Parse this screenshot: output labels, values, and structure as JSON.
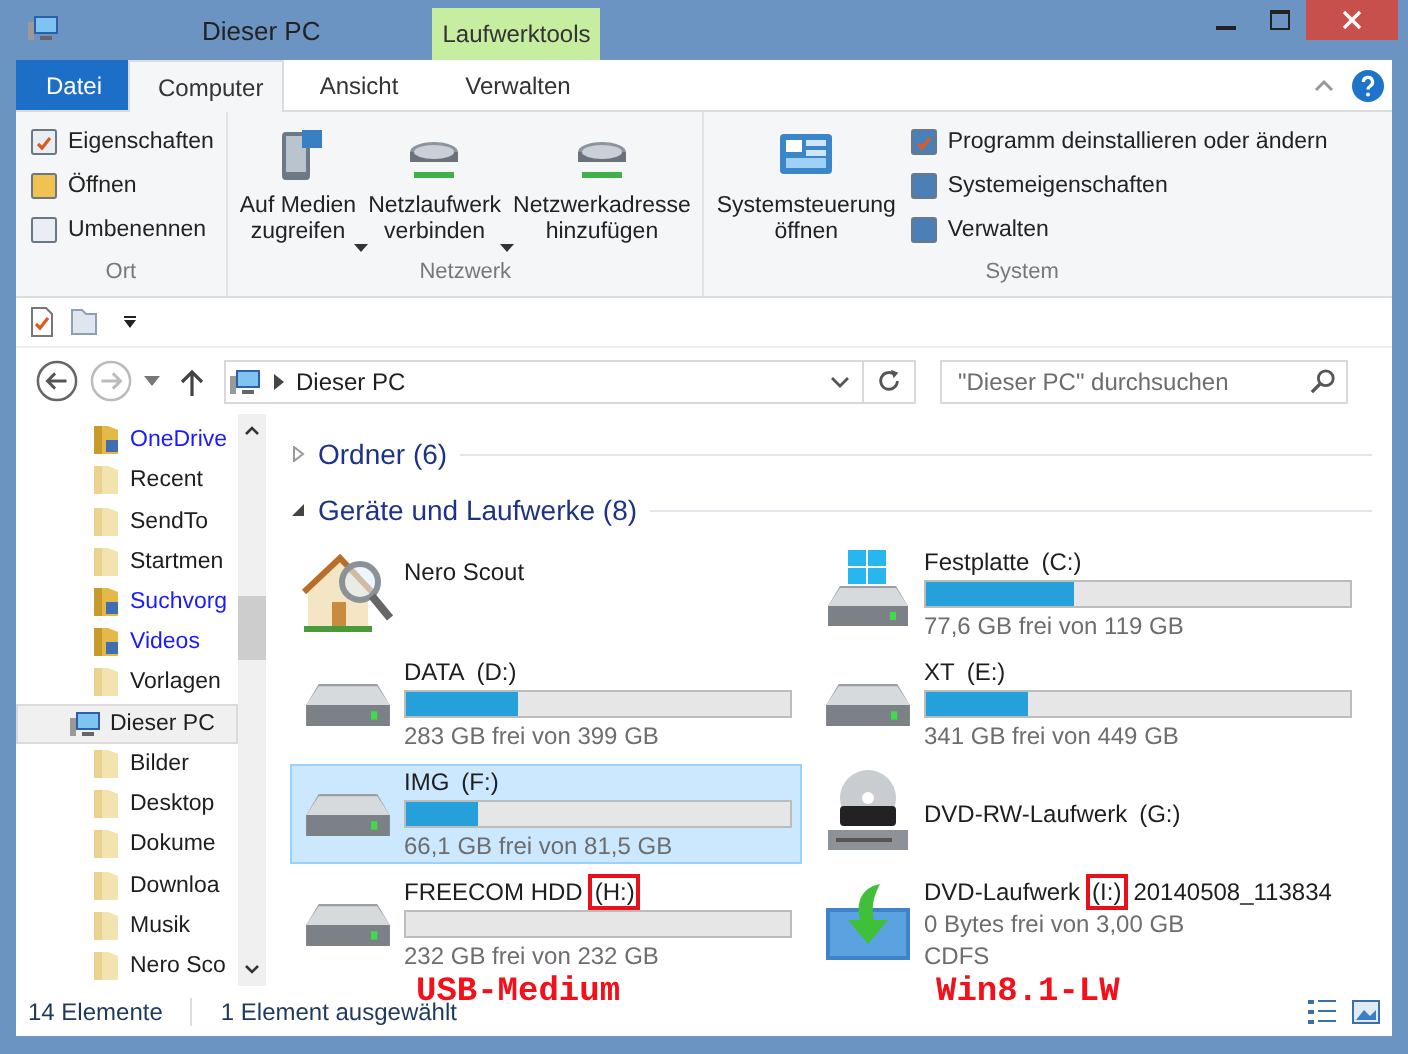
{
  "window": {
    "title": "Dieser PC",
    "context_group": "Laufwerktools"
  },
  "ribbon_tabs": [
    {
      "label": "Datei",
      "kind": "file",
      "selected": false
    },
    {
      "label": "Computer",
      "kind": "tab",
      "selected": true
    },
    {
      "label": "Ansicht",
      "kind": "tab",
      "selected": false
    },
    {
      "label": "Verwalten",
      "kind": "context",
      "selected": false
    }
  ],
  "ribbon_groups": [
    {
      "name": "Ort",
      "buttons": [
        {
          "kind": "small",
          "lines": [
            "Eigenschaften"
          ]
        },
        {
          "kind": "small",
          "lines": [
            "Öffnen"
          ]
        },
        {
          "kind": "small",
          "lines": [
            "Umbenennen"
          ]
        }
      ]
    },
    {
      "name": "Netzwerk",
      "buttons": [
        {
          "kind": "large",
          "lines": [
            "Auf Medien",
            "zugreifen"
          ],
          "dropdown": true
        },
        {
          "kind": "large",
          "lines": [
            "Netzlaufwerk",
            "verbinden"
          ],
          "dropdown": true
        },
        {
          "kind": "large",
          "lines": [
            "Netzwerkadresse",
            "hinzufügen"
          ],
          "dropdown": false
        }
      ]
    },
    {
      "name": "System",
      "buttons": [
        {
          "kind": "large",
          "lines": [
            "Systemsteuerung",
            "öffnen"
          ],
          "dropdown": false
        },
        {
          "kind": "small",
          "lines": [
            "Programm deinstallieren oder ändern"
          ]
        },
        {
          "kind": "small",
          "lines": [
            "Systemeigenschaften"
          ]
        },
        {
          "kind": "small",
          "lines": [
            "Verwalten"
          ]
        }
      ]
    }
  ],
  "address": {
    "location": "Dieser PC",
    "search_placeholder": "\"Dieser PC\" durchsuchen"
  },
  "sidebar": {
    "items": [
      {
        "label": "OneDrive",
        "kind": "special",
        "selected": false
      },
      {
        "label": "Recent",
        "kind": "folder",
        "selected": false
      },
      {
        "label": "SendTo",
        "kind": "folder",
        "selected": false
      },
      {
        "label": "Startmen",
        "kind": "folder",
        "selected": false
      },
      {
        "label": "Suchvorg",
        "kind": "special",
        "selected": false
      },
      {
        "label": "Videos",
        "kind": "special",
        "selected": false
      },
      {
        "label": "Vorlagen",
        "kind": "folder",
        "selected": false
      },
      {
        "label": "Dieser PC",
        "kind": "computer",
        "selected": true,
        "children": [
          {
            "label": "Bilder",
            "kind": "folder",
            "selected": false
          },
          {
            "label": "Desktop",
            "kind": "folder",
            "selected": false
          },
          {
            "label": "Dokume",
            "kind": "folder",
            "selected": false
          },
          {
            "label": "Downloa",
            "kind": "folder",
            "selected": false
          },
          {
            "label": "Musik",
            "kind": "folder",
            "selected": false
          },
          {
            "label": "Nero Sco",
            "kind": "folder",
            "selected": false
          }
        ]
      }
    ]
  },
  "sections": [
    {
      "title": "Ordner (6)",
      "expanded": false
    },
    {
      "title": "Geräte und Laufwerke (8)",
      "expanded": true,
      "drives": [
        {
          "kind": "app",
          "name": "Nero Scout",
          "selected": false
        },
        {
          "kind": "system",
          "name": "Festplatte",
          "letter": "(C:)",
          "level": 0.35,
          "free": "77,6 GB frei von 119 GB",
          "selected": false
        },
        {
          "kind": "hdd",
          "name": "DATA",
          "letter": "(D:)",
          "level": 0.29,
          "free": "283 GB frei von 399 GB",
          "selected": false
        },
        {
          "kind": "hdd",
          "name": "XT",
          "letter": "(E:)",
          "level": 0.24,
          "free": "341 GB frei von 449 GB",
          "selected": false
        },
        {
          "kind": "hdd",
          "name": "IMG",
          "letter": "(F:)",
          "level": 0.19,
          "free": "66,1 GB frei von 81,5 GB",
          "selected": true
        },
        {
          "kind": "dvd",
          "name": "DVD-RW-Laufwerk",
          "letter": "(G:)",
          "selected": false
        },
        {
          "kind": "hdd",
          "name": "FREECOM HDD",
          "letter": "(H:)",
          "level": 0,
          "free": "232 GB frei von 232 GB",
          "selected": false,
          "marked": true,
          "annotation": "USB-Medium"
        },
        {
          "kind": "mounted",
          "name": "DVD-Laufwerk",
          "letter": "(I:)",
          "volume": "20140508_113834",
          "free": "0 Bytes frei von 3,00 GB",
          "filesystem": "CDFS",
          "selected": false,
          "marked": true,
          "annotation": "Win8.1-LW"
        }
      ]
    }
  ],
  "status_bar": {
    "count": "14 Elemente",
    "selection": "1 Element ausgewählt"
  }
}
